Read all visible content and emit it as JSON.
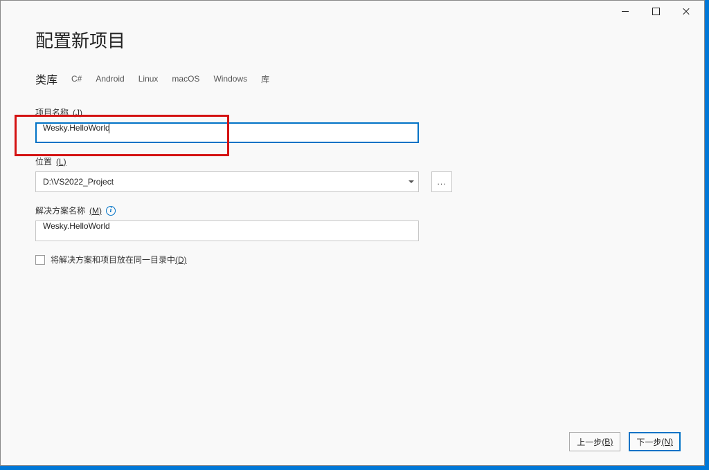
{
  "window": {
    "title_controls": {
      "minimize": "minimize",
      "maximize": "maximize",
      "close": "close"
    }
  },
  "page": {
    "title": "配置新项目"
  },
  "tags": {
    "primary": "类库",
    "items": [
      "C#",
      "Android",
      "Linux",
      "macOS",
      "Windows",
      "库"
    ]
  },
  "fields": {
    "project_name": {
      "label_text": "项目名称",
      "label_key": "(J)",
      "value": "Wesky.HelloWorld"
    },
    "location": {
      "label_text": "位置",
      "label_key": "(L)",
      "value": "D:\\VS2022_Project",
      "browse": "..."
    },
    "solution_name": {
      "label_text": "解决方案名称",
      "label_key": "(M)",
      "value": "Wesky.HelloWorld"
    },
    "same_dir_checkbox": {
      "label_text": "将解决方案和项目放在同一目录中",
      "label_key": "(D)",
      "checked": false
    }
  },
  "footer": {
    "back_label": "上一步",
    "back_key": "(B)",
    "next_label": "下一步",
    "next_key": "(N)"
  }
}
